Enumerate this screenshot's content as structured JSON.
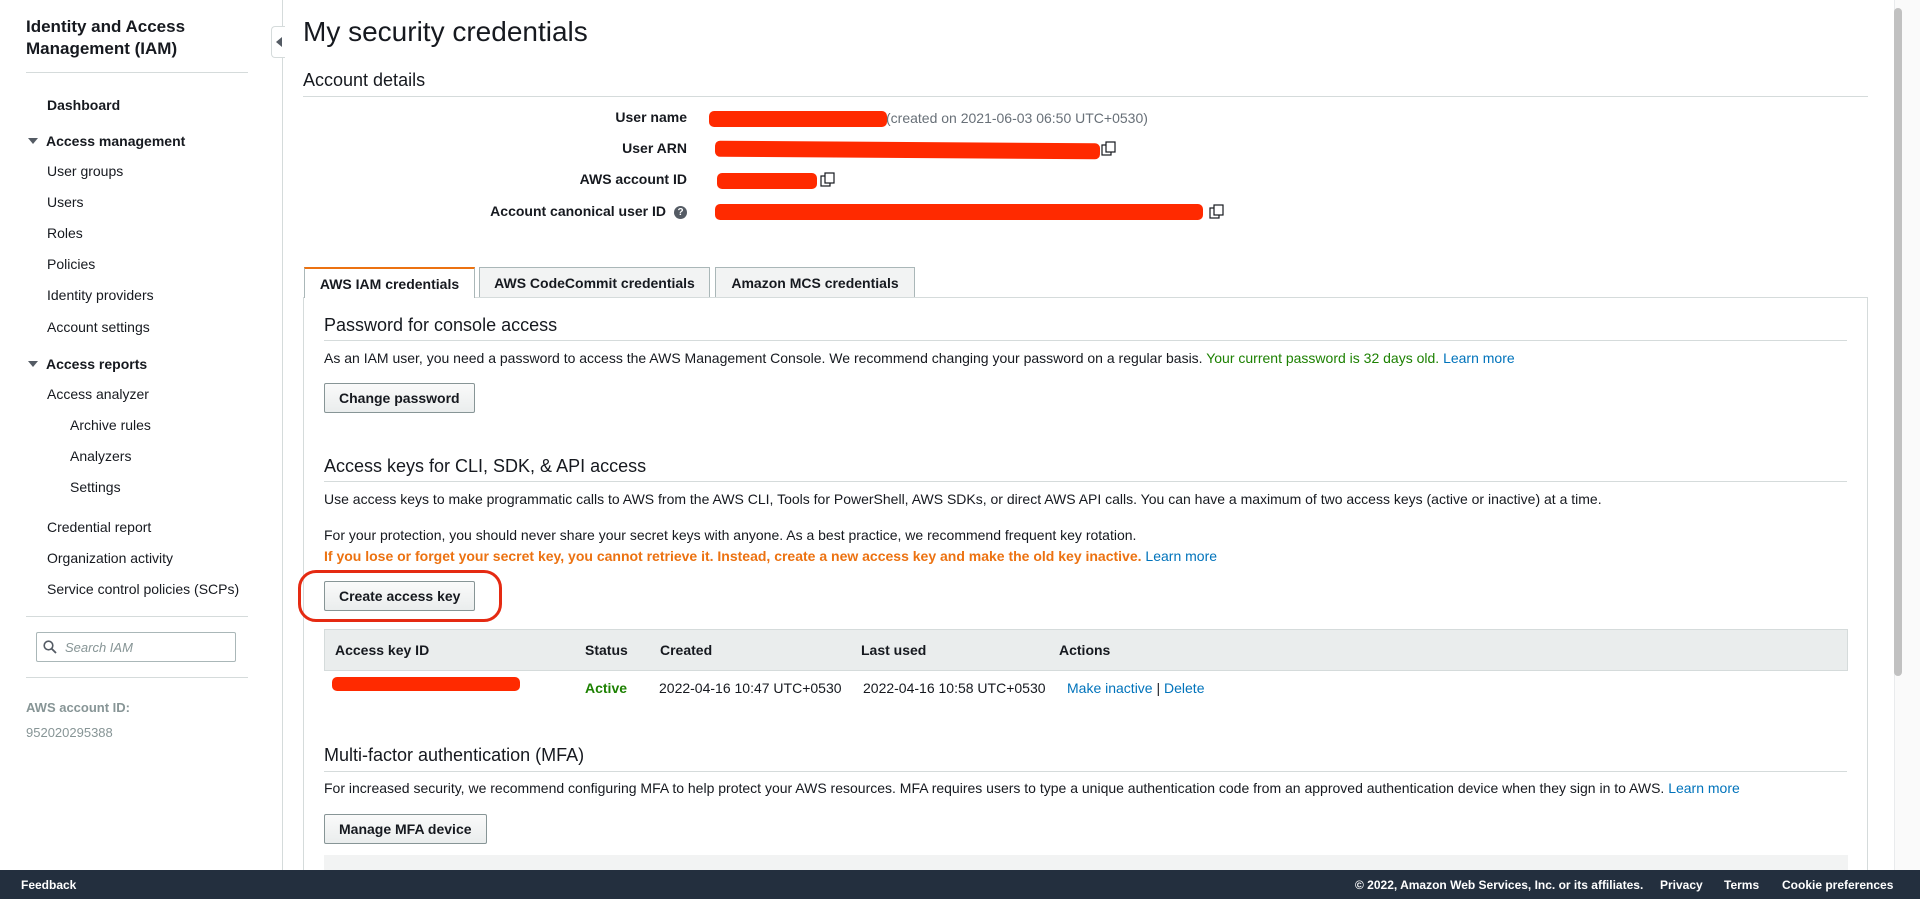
{
  "sidebar": {
    "title": "Identity and Access Management (IAM)",
    "dashboard": "Dashboard",
    "access_management": {
      "label": "Access management",
      "items": [
        "User groups",
        "Users",
        "Roles",
        "Policies",
        "Identity providers",
        "Account settings"
      ]
    },
    "access_reports": {
      "label": "Access reports",
      "access_analyzer": "Access analyzer",
      "analyzer_subitems": [
        "Archive rules",
        "Analyzers",
        "Settings"
      ],
      "items": [
        "Credential report",
        "Organization activity",
        "Service control policies (SCPs)"
      ]
    },
    "search_placeholder": "Search IAM",
    "account_id_label": "AWS account ID:",
    "account_id_value": "952020295388"
  },
  "main": {
    "title": "My security credentials",
    "account_details": {
      "heading": "Account details",
      "user_name_label": "User name",
      "user_name_suffix": "(created on 2021-06-03 06:50 UTC+0530)",
      "user_arn_label": "User ARN",
      "aws_account_id_label": "AWS account ID",
      "canonical_user_id_label": "Account canonical user ID"
    },
    "tabs": [
      "AWS IAM credentials",
      "AWS CodeCommit credentials",
      "Amazon MCS credentials"
    ],
    "password_section": {
      "heading": "Password for console access",
      "text": "As an IAM user, you need a password to access the AWS Management Console. We recommend changing your password on a regular basis.",
      "status": "Your current password is 32 days old.",
      "learn_more": "Learn more",
      "button": "Change password"
    },
    "access_keys_section": {
      "heading": "Access keys for CLI, SDK, & API access",
      "text1": "Use access keys to make programmatic calls to AWS from the AWS CLI, Tools for PowerShell, AWS SDKs, or direct AWS API calls. You can have a maximum of two access keys (active or inactive) at a time.",
      "text2": "For your protection, you should never share your secret keys with anyone. As a best practice, we recommend frequent key rotation.",
      "warning": "If you lose or forget your secret key, you cannot retrieve it. Instead, create a new access key and make the old key inactive.",
      "learn_more": "Learn more",
      "button": "Create access key",
      "table": {
        "columns": [
          "Access key ID",
          "Status",
          "Created",
          "Last used",
          "Actions"
        ],
        "rows": [
          {
            "status": "Active",
            "created": "2022-04-16 10:47 UTC+0530",
            "last_used": "2022-04-16 10:58 UTC+0530",
            "action_inactive": "Make inactive",
            "separator": "|",
            "action_delete": "Delete"
          }
        ]
      }
    },
    "mfa_section": {
      "heading": "Multi-factor authentication (MFA)",
      "text": "For increased security, we recommend configuring MFA to help protect your AWS resources. MFA requires users to type a unique authentication code from an approved authentication device when they sign in to AWS.",
      "learn_more": "Learn more",
      "button": "Manage MFA device"
    }
  },
  "footer": {
    "feedback": "Feedback",
    "copyright": "© 2022, Amazon Web Services, Inc. or its affiliates.",
    "privacy": "Privacy",
    "terms": "Terms",
    "cookies": "Cookie preferences"
  },
  "colors": {
    "redaction": "#ff2a00",
    "highlight_circle": "#e52a12",
    "tab_accent": "#ec7211",
    "success_green": "#1d8102",
    "link_blue": "#0073bb",
    "footer_bg": "#232f3e"
  }
}
